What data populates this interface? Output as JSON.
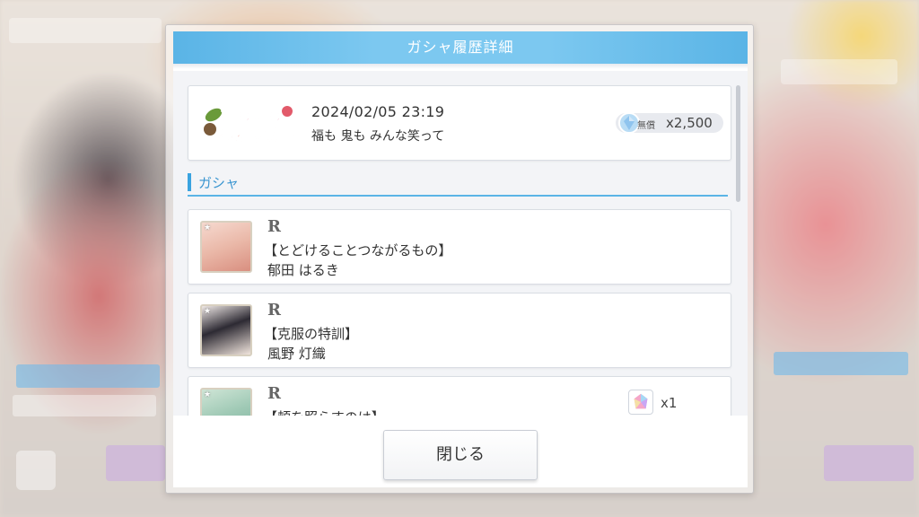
{
  "dialog": {
    "title": "ガシャ履歴詳細",
    "close_label": "閉じる"
  },
  "summary": {
    "banner_text": "福も鬼も みんな笑って",
    "datetime": "2024/02/05 23:19",
    "gacha_name": "福も 鬼も みんな笑って",
    "currency_icon": "gem-icon",
    "free_label": "無償",
    "cost": "x2,500"
  },
  "section": {
    "title": "ガシャ"
  },
  "results": [
    {
      "rarity": "R",
      "card_title": "【とどけることつながるもの】",
      "member": "郁田 はるき"
    },
    {
      "rarity": "R",
      "card_title": "【克服の特訓】",
      "member": "風野 灯織"
    },
    {
      "rarity": "R",
      "card_title": "【頬を照らすのは】",
      "member": "",
      "bonus_icon": "piece-icon",
      "bonus_count": "x1"
    }
  ],
  "colors": {
    "header": "#7cc8f0",
    "accent": "#3aa3e0"
  }
}
